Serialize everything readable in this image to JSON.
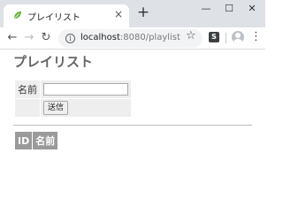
{
  "browser": {
    "tab_title": "プレイリスト",
    "tab_close": "×",
    "new_tab": "+",
    "window_controls": {
      "minimize": "—",
      "maximize": "☐",
      "close": "✕"
    },
    "nav": {
      "back": "←",
      "forward": "→",
      "reload": "↻"
    },
    "address": {
      "host": "localhost",
      "rest": ":8080/playlist"
    },
    "extension_label": "S",
    "menu_glyph": "⋮",
    "icons": [
      "leaf-favicon-icon",
      "info-icon",
      "star-icon",
      "extension-icon",
      "profile-icon"
    ]
  },
  "page": {
    "title": "プレイリスト",
    "form": {
      "name_label": "名前",
      "name_value": "",
      "submit_label": "送信"
    },
    "table": {
      "columns": [
        "ID",
        "名前"
      ]
    }
  }
}
